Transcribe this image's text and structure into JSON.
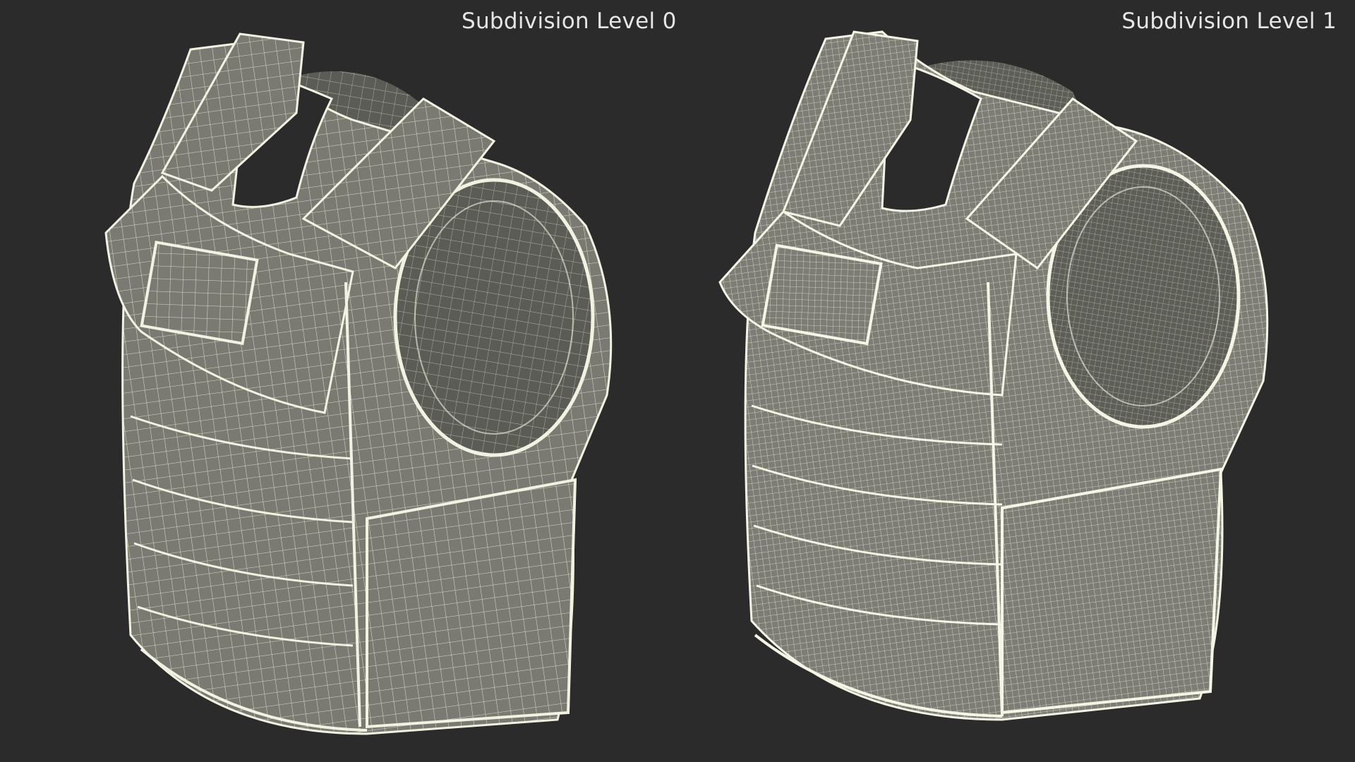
{
  "labels": {
    "level0": "Subdivision Level 0",
    "level1": "Subdivision Level 1"
  },
  "colors": {
    "background": "#2b2b2b",
    "mesh_fill": "#7a7a72",
    "wire": "#e9e9d6",
    "label_text": "#e6e6e6"
  },
  "views": [
    {
      "name": "subdivision-level-0-view",
      "wire_density": "coarse"
    },
    {
      "name": "subdivision-level-1-view",
      "wire_density": "fine"
    }
  ]
}
